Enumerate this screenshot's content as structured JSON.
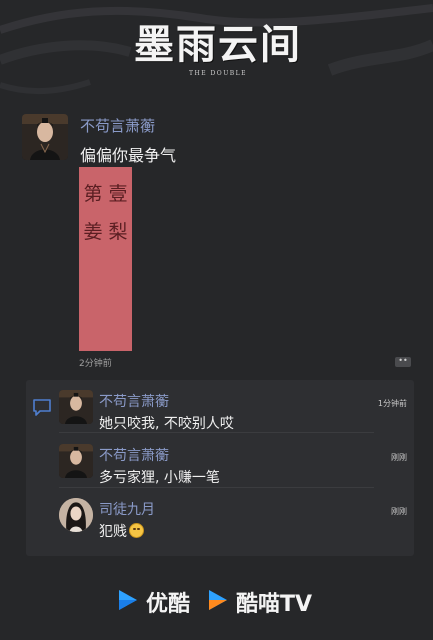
{
  "header": {
    "show_title": "墨雨云间",
    "show_subtitle": "THE DOUBLE"
  },
  "post": {
    "author": "不苟言萧蘅",
    "text": "偏偏你最争气",
    "image_text": "第 壹 姜 梨",
    "time": "2分钟前",
    "more_label": "••"
  },
  "comments": [
    {
      "author": "不苟言萧蘅",
      "text": "她只咬我, 不咬别人哎",
      "time": "1分钟前"
    },
    {
      "author": "不苟言萧蘅",
      "text": "多亏家狸, 小赚一笔",
      "time": "刚刚"
    },
    {
      "author": "司徒九月",
      "text": "犯贱",
      "time": "刚刚"
    }
  ],
  "footer": {
    "brand_youku": "优酷",
    "brand_kumiao": "酷喵TV"
  },
  "colors": {
    "background": "#262729",
    "name_accent": "#8a9ac8",
    "panel": "#2e2f32",
    "logo_blue": "#2ea2ff",
    "logo_orange": "#ff8a1e"
  }
}
